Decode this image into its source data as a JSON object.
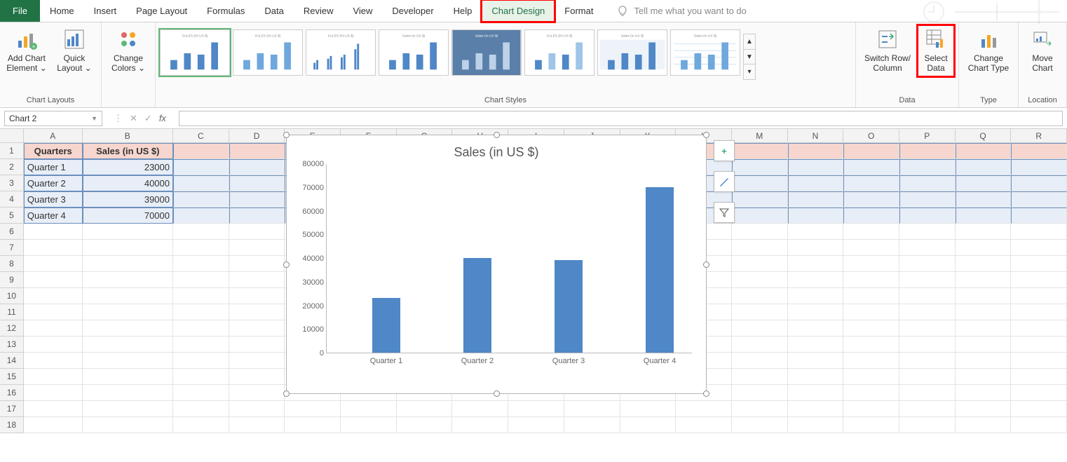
{
  "ribbon": {
    "tabs": [
      "File",
      "Home",
      "Insert",
      "Page Layout",
      "Formulas",
      "Data",
      "Review",
      "View",
      "Developer",
      "Help",
      "Chart Design",
      "Format"
    ],
    "active_tab": "Chart Design",
    "tellme_placeholder": "Tell me what you want to do",
    "groups": {
      "chart_layouts": {
        "label": "Chart Layouts",
        "add_chart_element": "Add Chart Element ⌄",
        "quick_layout": "Quick Layout ⌄"
      },
      "colors": {
        "change_colors": "Change Colors ⌄"
      },
      "chart_styles": {
        "label": "Chart Styles"
      },
      "data": {
        "label": "Data",
        "switch": "Switch Row/\nColumn",
        "select_data": "Select Data"
      },
      "type": {
        "label": "Type",
        "change_type": "Change Chart Type"
      },
      "location": {
        "label": "Location",
        "move_chart": "Move Chart"
      }
    }
  },
  "formula_bar": {
    "name_box": "Chart 2",
    "fx": "fx",
    "formula": ""
  },
  "sheet": {
    "columns": [
      "A",
      "B",
      "C",
      "D",
      "E",
      "F",
      "G",
      "H",
      "I",
      "J",
      "K",
      "L",
      "M",
      "N",
      "O",
      "P",
      "Q",
      "R"
    ],
    "row_count": 18,
    "table": {
      "headers": [
        "Quarters",
        "Sales (in US $)"
      ],
      "rows": [
        [
          "Quarter 1",
          "23000"
        ],
        [
          "Quarter 2",
          "40000"
        ],
        [
          "Quarter 3",
          "39000"
        ],
        [
          "Quarter 4",
          "70000"
        ]
      ]
    }
  },
  "chart_side": {
    "plus": "+",
    "brush": "🖌",
    "filter": "▾"
  },
  "highlights": {
    "tab": "Chart Design",
    "button": "Select Data"
  },
  "chart_data": {
    "type": "bar",
    "title": "Sales (in US $)",
    "categories": [
      "Quarter 1",
      "Quarter 2",
      "Quarter 3",
      "Quarter 4"
    ],
    "values": [
      23000,
      40000,
      39000,
      70000
    ],
    "xlabel": "",
    "ylabel": "",
    "ylim": [
      0,
      80000
    ],
    "yticks": [
      0,
      10000,
      20000,
      30000,
      40000,
      50000,
      60000,
      70000,
      80000
    ]
  }
}
